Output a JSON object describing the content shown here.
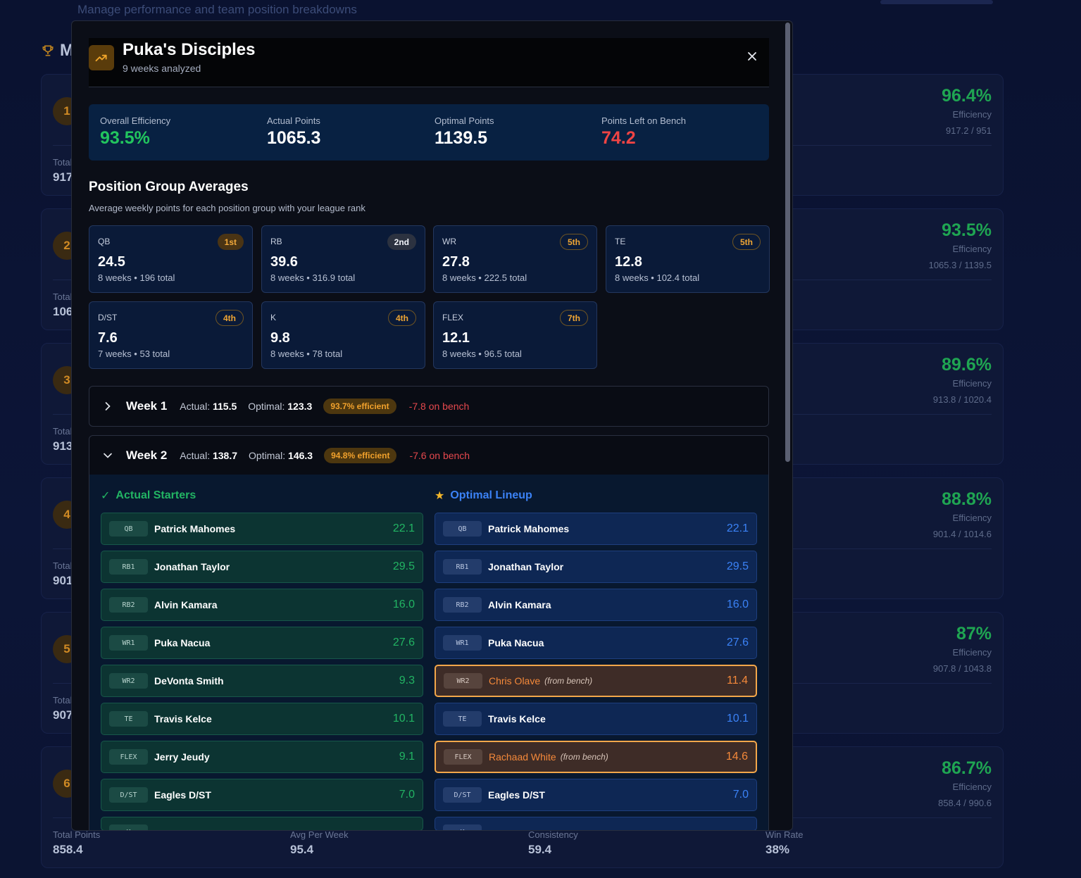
{
  "background": {
    "subtitle": "Manage performance and team position breakdowns",
    "heading": "M",
    "cards": [
      {
        "rank": "1",
        "efficiency": "96.4%",
        "efficiency_label": "Efficiency",
        "ratio": "917.2 / 951",
        "total_label": "Total",
        "total_value": "917."
      },
      {
        "rank": "2",
        "efficiency": "93.5%",
        "efficiency_label": "Efficiency",
        "ratio": "1065.3 / 1139.5",
        "total_label": "Total",
        "total_value": "106"
      },
      {
        "rank": "3",
        "efficiency": "89.6%",
        "efficiency_label": "Efficiency",
        "ratio": "913.8 / 1020.4",
        "total_label": "Total",
        "total_value": "913"
      },
      {
        "rank": "4",
        "efficiency": "88.8%",
        "efficiency_label": "Efficiency",
        "ratio": "901.4 / 1014.6",
        "total_label": "Total",
        "total_value": "901"
      },
      {
        "rank": "5",
        "efficiency": "87%",
        "efficiency_label": "Efficiency",
        "ratio": "907.8 / 1043.8",
        "total_label": "Total",
        "total_value": "907"
      },
      {
        "rank": "6",
        "efficiency": "86.7%",
        "efficiency_label": "Efficiency",
        "ratio": "858.4 / 990.6",
        "total_label": "Total Points",
        "total_value": "858.4"
      }
    ],
    "last_card_stats": [
      {
        "label": "Avg Per Week",
        "value": "95.4"
      },
      {
        "label": "Consistency",
        "value": "59.4"
      },
      {
        "label": "Win Rate",
        "value": "38%"
      }
    ]
  },
  "modal": {
    "title": "Puka's Disciples",
    "subtitle": "9 weeks analyzed",
    "summary": [
      {
        "label": "Overall Efficiency",
        "value": "93.5%",
        "color": "#22c55e"
      },
      {
        "label": "Actual Points",
        "value": "1065.3",
        "color": "#ffffff"
      },
      {
        "label": "Optimal Points",
        "value": "1139.5",
        "color": "#ffffff"
      },
      {
        "label": "Points Left on Bench",
        "value": "74.2",
        "color": "#ef4444"
      }
    ],
    "position_section": {
      "title": "Position Group Averages",
      "subtitle": "Average weekly points for each position group with your league rank"
    },
    "positions": [
      {
        "name": "QB",
        "rank": "1st",
        "value": "24.5",
        "detail": "8 weeks • 196 total"
      },
      {
        "name": "RB",
        "rank": "2nd",
        "value": "39.6",
        "detail": "8 weeks • 316.9 total"
      },
      {
        "name": "WR",
        "rank": "5th",
        "value": "27.8",
        "detail": "8 weeks • 222.5 total"
      },
      {
        "name": "TE",
        "rank": "5th",
        "value": "12.8",
        "detail": "8 weeks • 102.4 total"
      },
      {
        "name": "D/ST",
        "rank": "4th",
        "value": "7.6",
        "detail": "7 weeks • 53 total"
      },
      {
        "name": "K",
        "rank": "4th",
        "value": "9.8",
        "detail": "8 weeks • 78 total"
      },
      {
        "name": "FLEX",
        "rank": "7th",
        "value": "12.1",
        "detail": "8 weeks • 96.5 total"
      }
    ],
    "weeks": [
      {
        "name": "Week 1",
        "actual_label": "Actual:",
        "actual": "115.5",
        "optimal_label": "Optimal:",
        "optimal": "123.3",
        "efficiency": "93.7% efficient",
        "bench": "-7.8 on bench",
        "expanded": false
      },
      {
        "name": "Week 2",
        "actual_label": "Actual:",
        "actual": "138.7",
        "optimal_label": "Optimal:",
        "optimal": "146.3",
        "efficiency": "94.8% efficient",
        "bench": "-7.6 on bench",
        "expanded": true
      }
    ],
    "week2": {
      "actual_title": "Actual Starters",
      "optimal_title": "Optimal Lineup",
      "actual_starters": [
        {
          "pos": "QB",
          "name": "Patrick Mahomes",
          "pts": "22.1"
        },
        {
          "pos": "RB1",
          "name": "Jonathan Taylor",
          "pts": "29.5"
        },
        {
          "pos": "RB2",
          "name": "Alvin Kamara",
          "pts": "16.0"
        },
        {
          "pos": "WR1",
          "name": "Puka Nacua",
          "pts": "27.6"
        },
        {
          "pos": "WR2",
          "name": "DeVonta Smith",
          "pts": "9.3"
        },
        {
          "pos": "TE",
          "name": "Travis Kelce",
          "pts": "10.1"
        },
        {
          "pos": "FLEX",
          "name": "Jerry Jeudy",
          "pts": "9.1"
        },
        {
          "pos": "D/ST",
          "name": "Eagles D/ST",
          "pts": "7.0"
        },
        {
          "pos": "K",
          "name": "",
          "pts": ""
        }
      ],
      "optimal_lineup": [
        {
          "pos": "QB",
          "name": "Patrick Mahomes",
          "pts": "22.1",
          "from_bench": false
        },
        {
          "pos": "RB1",
          "name": "Jonathan Taylor",
          "pts": "29.5",
          "from_bench": false
        },
        {
          "pos": "RB2",
          "name": "Alvin Kamara",
          "pts": "16.0",
          "from_bench": false
        },
        {
          "pos": "WR1",
          "name": "Puka Nacua",
          "pts": "27.6",
          "from_bench": false
        },
        {
          "pos": "WR2",
          "name": "Chris Olave",
          "pts": "11.4",
          "from_bench": true,
          "note": "(from bench)"
        },
        {
          "pos": "TE",
          "name": "Travis Kelce",
          "pts": "10.1",
          "from_bench": false
        },
        {
          "pos": "FLEX",
          "name": "Rachaad White",
          "pts": "14.6",
          "from_bench": true,
          "note": "(from bench)"
        },
        {
          "pos": "D/ST",
          "name": "Eagles D/ST",
          "pts": "7.0",
          "from_bench": false
        },
        {
          "pos": "K",
          "name": "",
          "pts": "",
          "from_bench": false
        }
      ]
    }
  }
}
